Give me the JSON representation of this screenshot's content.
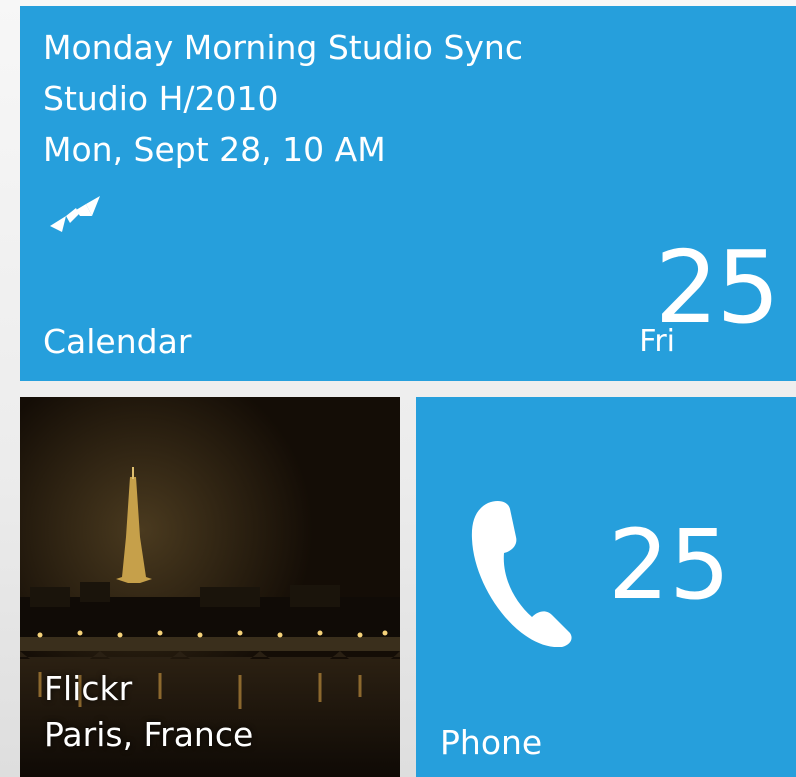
{
  "colors": {
    "tile_accent": "#269fdc",
    "text": "#ffffff"
  },
  "calendar": {
    "event_title": "Monday Morning Studio Sync",
    "event_location": "Studio H/2010",
    "event_time": "Mon, Sept 28, 10 AM",
    "label": "Calendar",
    "day_name": "Fri",
    "day_number": "25",
    "icon": "sync-arrows-icon"
  },
  "photo": {
    "source": "Flickr",
    "place": "Paris, France",
    "image": "eiffel-tower-night-photo"
  },
  "phone": {
    "icon": "phone-handset-icon",
    "count": "25",
    "label": "Phone"
  }
}
